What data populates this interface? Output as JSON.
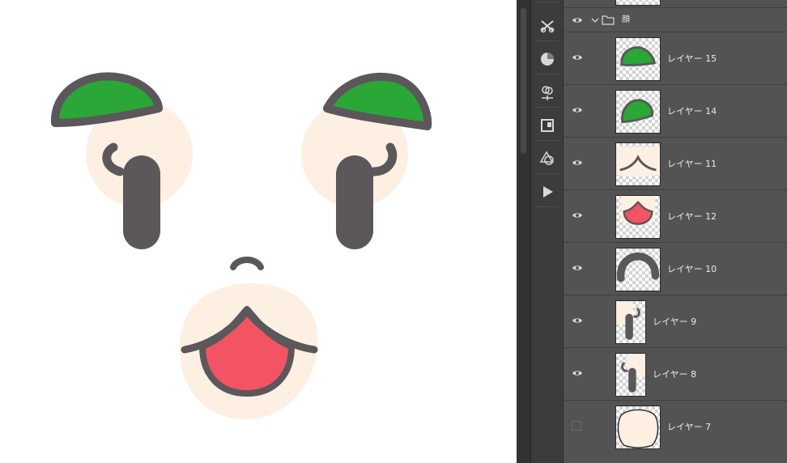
{
  "canvas": {
    "colors": {
      "skin": "#fdefe2",
      "hat_green": "#2aa737",
      "outline": "#5b575a",
      "mouth_red": "#f25463"
    }
  },
  "tools": [
    {
      "name": "adjustments-tool-icon"
    },
    {
      "name": "color-circle-icon"
    },
    {
      "name": "channels-icon"
    },
    {
      "name": "properties-panel-icon"
    },
    {
      "name": "shapes-icon"
    },
    {
      "name": "play-action-icon"
    }
  ],
  "layers_panel": {
    "group": {
      "name": "顔",
      "expanded": true,
      "visible": true
    },
    "layers": [
      {
        "name": "レイヤー 15",
        "visible": true
      },
      {
        "name": "レイヤー 14",
        "visible": true
      },
      {
        "name": "レイヤー 11",
        "visible": true
      },
      {
        "name": "レイヤー 12",
        "visible": true
      },
      {
        "name": "レイヤー 10",
        "visible": true
      },
      {
        "name": "レイヤー 9",
        "visible": true
      },
      {
        "name": "レイヤー 8",
        "visible": true
      },
      {
        "name": "レイヤー 7",
        "visible": false
      }
    ]
  }
}
